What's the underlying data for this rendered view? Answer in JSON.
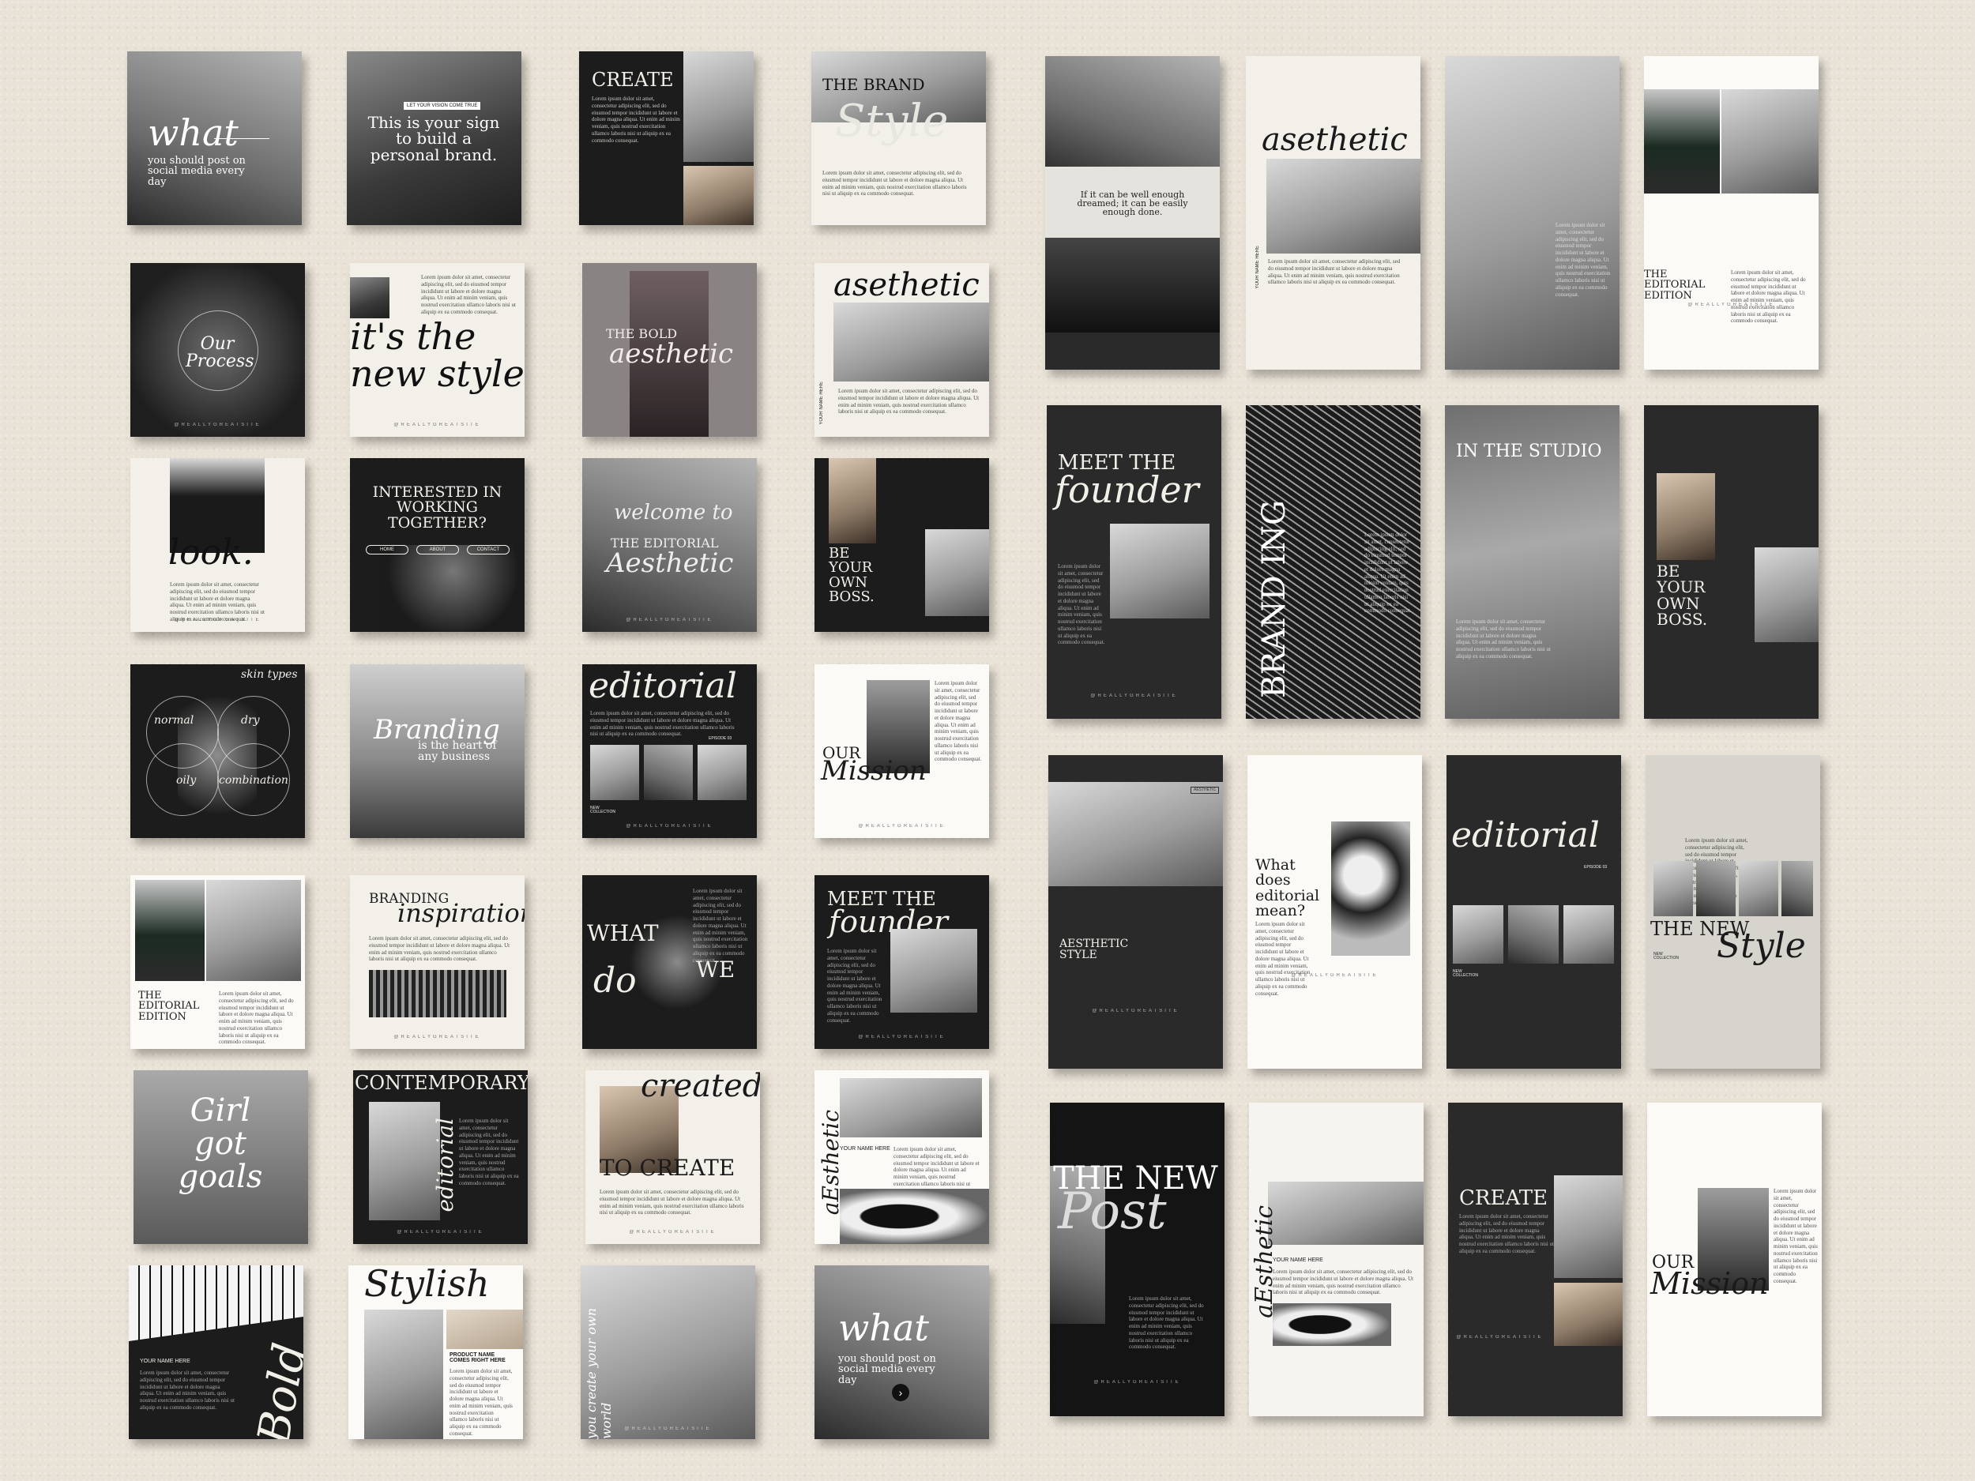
{
  "lorem": "Lorem ipsum dolor sit amet, consectetur adipiscing elit, sed do eiusmod tempor incididunt ut labore et dolore magna aliqua. Ut enim ad minim veniam, quis nostrud exercitation ullamco laboris nisi ut aliquip ex ea commodo consequat.",
  "handle": "@REALLYGREATSITE",
  "squares": {
    "what1": {
      "word": "what",
      "sub": "you should post on social media every day"
    },
    "sign": {
      "tag": "LET YOUR VISION COME TRUE",
      "text": "This is your sign to build a personal brand."
    },
    "create": {
      "title": "CREATE"
    },
    "brand_style": {
      "title": "THE BRAND",
      "script": "Style"
    },
    "process": {
      "script": "Our Process"
    },
    "new_style": {
      "script": "it's the new style"
    },
    "bold_aesthetic": {
      "title": "THE BOLD",
      "script": "aesthetic"
    },
    "asethetic1": {
      "script": "asethetic",
      "name": "YOUR NAME HERE"
    },
    "look": {
      "script": "look."
    },
    "interested": {
      "title": "INTERESTED IN WORKING TOGETHER?",
      "b1": "HOME",
      "b2": "ABOUT",
      "b3": "CONTACT"
    },
    "welcome": {
      "script1": "welcome to",
      "title": "THE EDITORIAL",
      "script2": "Aesthetic"
    },
    "boss1": {
      "title": "BE YOUR OWN BOSS."
    },
    "skin": {
      "script": "skin types",
      "a": "normal",
      "b": "dry",
      "c": "oily",
      "d": "combination"
    },
    "branding_heart": {
      "script": "Branding",
      "text": "is the heart of any business"
    },
    "editorial1": {
      "script": "editorial",
      "no": "EPISODE 03",
      "tag": "NEW COLLECTION"
    },
    "mission1": {
      "title": "OUR",
      "script": "Mission"
    },
    "editorial_edition": {
      "title": "THE EDITORIAL EDITION"
    },
    "branding_insp": {
      "title": "BRANDING",
      "script": "inspiration"
    },
    "what_we_do": {
      "w1": "WHAT",
      "w2": "do",
      "w3": "WE"
    },
    "founder1": {
      "title": "MEET THE",
      "script": "founder"
    },
    "girl_goals": {
      "script": "Girl got goals"
    },
    "contemporary": {
      "title": "CONTEMPORARY",
      "script": "editorial"
    },
    "created": {
      "script": "created",
      "title": "TO CREATE"
    },
    "aesthetic_coffee": {
      "script": "aEsthetic",
      "name": "YOUR NAME HERE"
    },
    "bold": {
      "script": "Bold",
      "name": "YOUR NAME HERE"
    },
    "stylish": {
      "script": "Stylish",
      "tag": "PRODUCT NAME COMES RIGHT HERE"
    },
    "your_own_world": {
      "script": "you create your own world"
    },
    "what2": {
      "word": "what",
      "sub": "you should post on social media every day",
      "arrow": "›"
    }
  },
  "stories": {
    "quote": {
      "text": "If it can be well enough dreamed; it can be easily enough done."
    },
    "asethetic2": {
      "script": "asethetic",
      "name": "YOUR NAME HERE"
    },
    "edition2": {
      "title": "THE EDITORIAL EDITION"
    },
    "founder2": {
      "title": "MEET THE",
      "script": "founder"
    },
    "branding": {
      "title": "BRAND ING"
    },
    "studio": {
      "title": "IN THE STUDIO"
    },
    "boss2": {
      "title": "BE YOUR OWN BOSS."
    },
    "aesthetic_style": {
      "title": "AESTHETIC STYLE",
      "tag": "AESTHETIC"
    },
    "what_does": {
      "title": "What does editorial mean?"
    },
    "editorial2": {
      "script": "editorial",
      "no": "EPISODE 03",
      "tag": "NEW COLLECTION"
    },
    "new_style": {
      "title": "THE NEW",
      "script": "Style",
      "tag": "NEW COLLECTION"
    },
    "new_post": {
      "title": "THE NEW",
      "script": "Post"
    },
    "aesthetic3": {
      "script": "aEsthetic",
      "name": "YOUR NAME HERE"
    },
    "create2": {
      "title": "CREATE"
    },
    "mission2": {
      "title": "OUR",
      "script": "Mission"
    }
  }
}
